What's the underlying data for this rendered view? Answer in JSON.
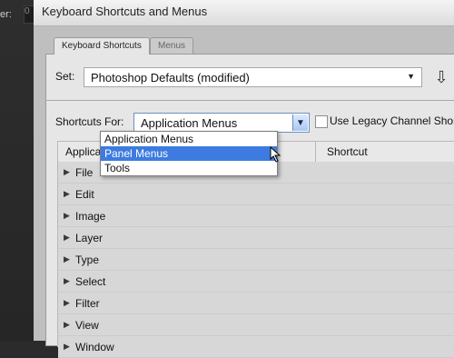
{
  "left_app": {
    "label": "er:",
    "field_value": "0"
  },
  "dialog": {
    "title": "Keyboard Shortcuts and Menus"
  },
  "tabs": [
    {
      "label": "Keyboard Shortcuts",
      "active": true
    },
    {
      "label": "Menus",
      "active": false
    }
  ],
  "set": {
    "label": "Set:",
    "value": "Photoshop Defaults (modified)"
  },
  "shortcuts_for": {
    "label": "Shortcuts For:",
    "value": "Application Menus",
    "options": [
      "Application Menus",
      "Panel Menus",
      "Tools"
    ],
    "highlighted_option": "Panel Menus"
  },
  "legacy": {
    "label": "Use Legacy Channel Shor"
  },
  "table": {
    "columns": [
      "Application M",
      "Shortcut"
    ],
    "rows": [
      "File",
      "Edit",
      "Image",
      "Layer",
      "Type",
      "Select",
      "Filter",
      "View",
      "Window"
    ]
  }
}
